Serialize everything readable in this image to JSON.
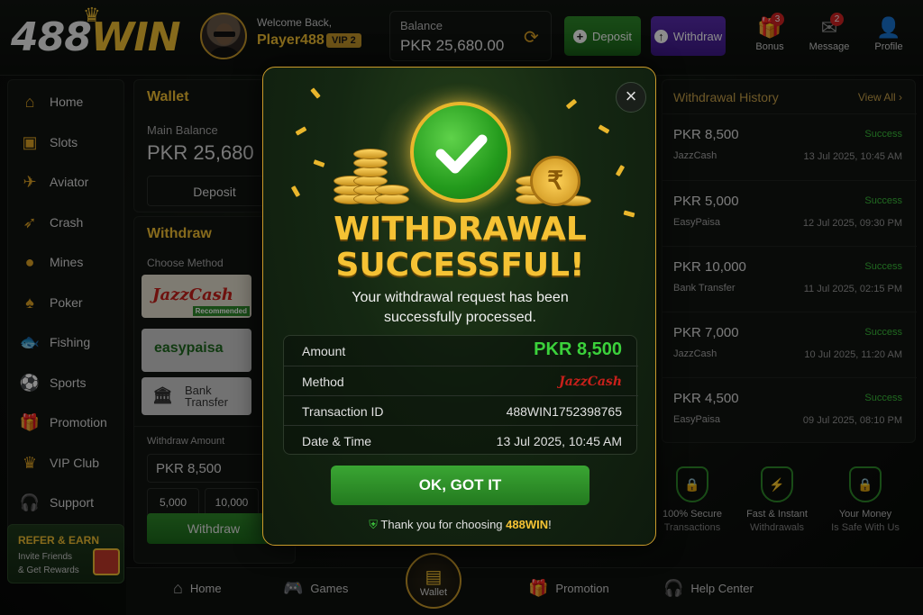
{
  "header": {
    "logo": {
      "text_a": "488",
      "text_b": "WIN"
    },
    "welcome": "Welcome Back,",
    "player": "Player488",
    "vip": "VIP 2",
    "balance_label": "Balance",
    "balance_value": "PKR 25,680.00",
    "deposit_label": "Deposit",
    "withdraw_label": "Withdraw",
    "icons": [
      {
        "label": "Bonus",
        "badge": "3"
      },
      {
        "label": "Message",
        "badge": "2"
      },
      {
        "label": "Profile",
        "badge": ""
      }
    ]
  },
  "sidebar": {
    "items": [
      "Home",
      "Slots",
      "Aviator",
      "Crash",
      "Mines",
      "Poker",
      "Fishing",
      "Sports",
      "Promotion",
      "VIP Club",
      "Support"
    ],
    "refer_title": "REFER & EARN",
    "refer_line1": "Invite Friends",
    "refer_line2": "& Get Rewards"
  },
  "wallet": {
    "title": "Wallet",
    "main_balance_label": "Main Balance",
    "main_balance_value": "PKR 25,680",
    "deposit_button": "Deposit"
  },
  "withdraw": {
    "title": "Withdraw",
    "choose_method": "Choose Method",
    "methods": [
      "JazzCash",
      "easypaisa",
      "Bank Transfer"
    ],
    "recommended": "Recommended",
    "amount_label": "Withdraw Amount",
    "amount_value": "PKR 8,500",
    "quick": [
      "5,000",
      "10,000"
    ],
    "button": "Withdraw"
  },
  "history": {
    "title": "Withdrawal History",
    "view_all": "View All ›",
    "rows": [
      {
        "amount": "PKR 8,500",
        "method": "JazzCash",
        "status": "Success",
        "date": "13 Jul 2025, 10:45 AM"
      },
      {
        "amount": "PKR 5,000",
        "method": "EasyPaisa",
        "status": "Success",
        "date": "12 Jul 2025, 09:30 PM"
      },
      {
        "amount": "PKR 10,000",
        "method": "Bank Transfer",
        "status": "Success",
        "date": "11 Jul 2025, 02:15 PM"
      },
      {
        "amount": "PKR 7,000",
        "method": "JazzCash",
        "status": "Success",
        "date": "10 Jul 2025, 11:20 AM"
      },
      {
        "amount": "PKR 4,500",
        "method": "EasyPaisa",
        "status": "Success",
        "date": "09 Jul 2025, 08:10 PM"
      }
    ]
  },
  "features": [
    {
      "l1": "100% Secure",
      "l2": "Transactions"
    },
    {
      "l1": "Fast & Instant",
      "l2": "Withdrawals"
    },
    {
      "l1": "Your Money",
      "l2": "Is Safe With Us"
    }
  ],
  "bottom_nav": [
    "Home",
    "Games",
    "Wallet",
    "Promotion",
    "Help Center"
  ],
  "modal": {
    "title_line1": "WITHDRAWAL",
    "title_line2": "SUCCESSFUL!",
    "subtitle_line1": "Your withdrawal request has been",
    "subtitle_line2": "successfully processed.",
    "rows": [
      {
        "key": "Amount",
        "value": "PKR 8,500"
      },
      {
        "key": "Method",
        "value": "JazzCash"
      },
      {
        "key": "Transaction ID",
        "value": "488WIN1752398765"
      },
      {
        "key": "Date & Time",
        "value": "13 Jul 2025, 10:45 AM"
      }
    ],
    "ok_button": "OK, GOT IT",
    "thanks_prefix": "Thank you for choosing ",
    "thanks_brand": "488WIN",
    "thanks_suffix": "!"
  },
  "colors": {
    "gold": "#f5c234",
    "green": "#3bd13b",
    "purple": "#5a2db0"
  }
}
